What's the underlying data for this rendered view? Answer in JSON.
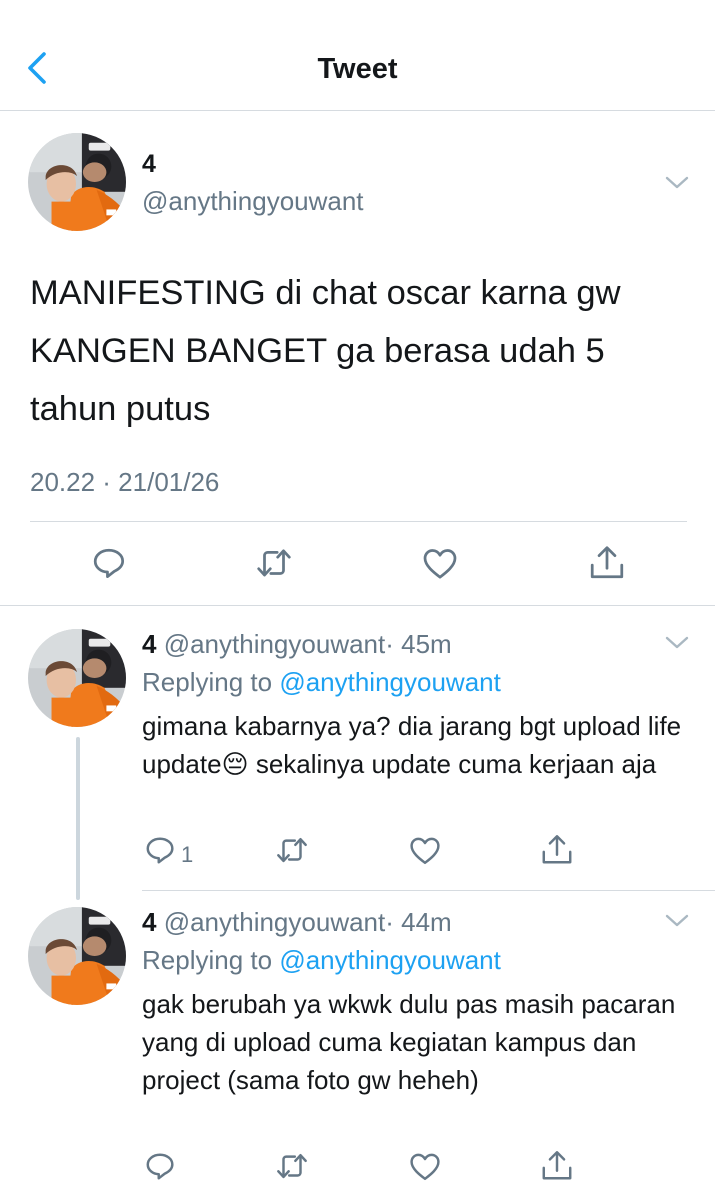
{
  "nav": {
    "title": "Tweet"
  },
  "main_tweet": {
    "name": "4",
    "handle": "@anythingyouwant",
    "text": "MANIFESTING di chat oscar karna gw KANGEN BANGET ga berasa udah 5 tahun putus",
    "time": "20.22 · 21/01/26"
  },
  "replies": [
    {
      "name": "4",
      "handle": "@anythingyouwant",
      "age": "· 45m",
      "replying_prefix": "Replying to",
      "replying_to": "@anythingyouwant",
      "text": "gimana kabarnya ya? dia jarang bgt upload life update😔 sekalinya update cuma kerjaan aja",
      "reply_count": "1"
    },
    {
      "name": "4",
      "handle": "@anythingyouwant",
      "age": "· 44m",
      "replying_prefix": "Replying to",
      "replying_to": "@anythingyouwant",
      "text": "gak berubah ya wkwk dulu pas masih pacaran yang di upload cuma kegiatan kampus dan project (sama foto gw heheh)",
      "reply_count": ""
    }
  ],
  "icons": [
    "back-chevron-icon",
    "chevron-down-icon",
    "reply-icon",
    "retweet-icon",
    "like-icon",
    "share-icon"
  ],
  "colors": {
    "accent": "#1da1f2",
    "secondary_text": "#657786",
    "icon_gray": "#657786",
    "divider": "#d6dbe0"
  }
}
